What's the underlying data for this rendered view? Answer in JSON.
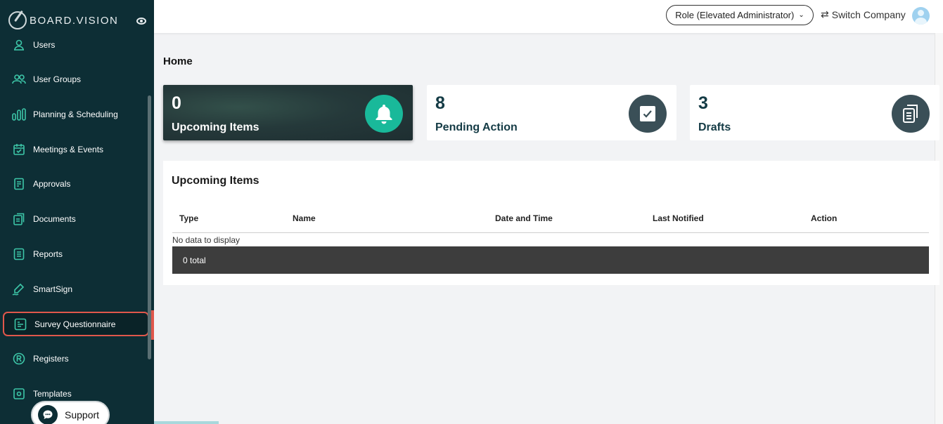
{
  "brand": {
    "name": "BOARD.VISION"
  },
  "sidebar": {
    "items": [
      {
        "label": "Users",
        "icon": "user-icon"
      },
      {
        "label": "User Groups",
        "icon": "users-icon"
      },
      {
        "label": "Planning & Scheduling",
        "icon": "bar-chart-icon"
      },
      {
        "label": "Meetings & Events",
        "icon": "calendar-check-icon"
      },
      {
        "label": "Approvals",
        "icon": "document-list-icon"
      },
      {
        "label": "Documents",
        "icon": "documents-icon"
      },
      {
        "label": "Reports",
        "icon": "report-list-icon"
      },
      {
        "label": "SmartSign",
        "icon": "signature-pen-icon"
      },
      {
        "label": "Survey Questionnaire",
        "icon": "survey-icon",
        "active": true
      },
      {
        "label": "Registers",
        "icon": "registered-icon"
      },
      {
        "label": "Templates",
        "icon": "template-icon"
      }
    ],
    "support_label": "Support"
  },
  "header": {
    "role_label": "Role (Elevated Administrator)",
    "switch_label": "Switch Company"
  },
  "main": {
    "title": "Home",
    "cards": [
      {
        "value": "0",
        "label": "Upcoming Items",
        "icon": "bell-icon"
      },
      {
        "value": "8",
        "label": "Pending Action",
        "icon": "checkbox-icon"
      },
      {
        "value": "3",
        "label": "Drafts",
        "icon": "drafts-icon"
      }
    ],
    "table": {
      "title": "Upcoming Items",
      "columns": [
        "Type",
        "Name",
        "Date and Time",
        "Last Notified",
        "Action"
      ],
      "empty_text": "No data to display",
      "total_text": "0 total"
    }
  },
  "colors": {
    "sidebar_bg": "#0d2e35",
    "accent_teal": "#19b99a",
    "active_outline": "#e0574b",
    "card_text": "#143b45"
  }
}
